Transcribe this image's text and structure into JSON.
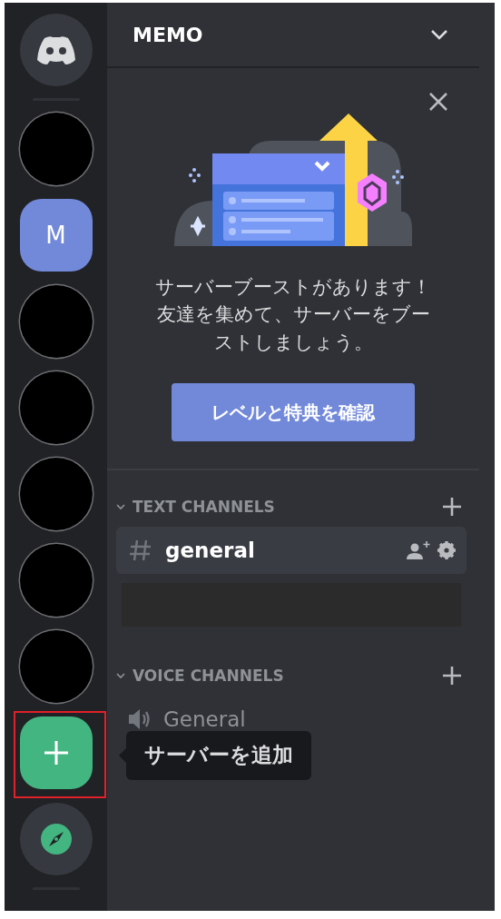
{
  "servers": [
    {
      "kind": "home"
    },
    {
      "kind": "avatar"
    },
    {
      "kind": "letter",
      "label": "M"
    },
    {
      "kind": "avatar"
    },
    {
      "kind": "avatar"
    },
    {
      "kind": "avatar"
    },
    {
      "kind": "avatar"
    },
    {
      "kind": "avatar"
    },
    {
      "kind": "add",
      "highlighted": true,
      "tooltip": "サーバーを追加"
    },
    {
      "kind": "explore"
    }
  ],
  "server_header": {
    "title": "MEMO"
  },
  "boost_card": {
    "message": "サーバーブーストがあります！友達を集めて、サーバーをブーストしましょう。",
    "button": "レベルと特典を確認"
  },
  "categories": [
    {
      "name": "TEXT CHANNELS",
      "channels": [
        {
          "kind": "text",
          "name": "general",
          "selected": true
        },
        {
          "kind": "redacted"
        }
      ]
    },
    {
      "name": "VOICE CHANNELS",
      "channels": [
        {
          "kind": "voice",
          "name": "General",
          "selected": false
        }
      ]
    }
  ]
}
